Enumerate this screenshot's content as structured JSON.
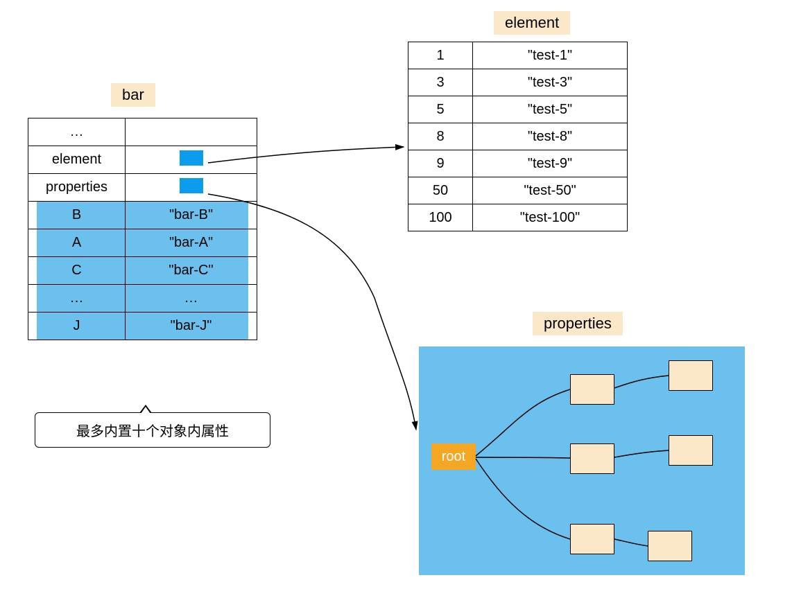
{
  "labels": {
    "bar": "bar",
    "element": "element",
    "properties": "properties"
  },
  "bar_table": {
    "rows": [
      {
        "k": "…",
        "v": ""
      },
      {
        "k": "element",
        "v": "[ptr]"
      },
      {
        "k": "properties",
        "v": "[ptr]"
      }
    ],
    "highlight_rows": [
      {
        "k": "B",
        "v": "\"bar-B\""
      },
      {
        "k": "A",
        "v": "\"bar-A\""
      },
      {
        "k": "C",
        "v": "\"bar-C\""
      },
      {
        "k": "…",
        "v": "…"
      },
      {
        "k": "J",
        "v": "\"bar-J\""
      }
    ]
  },
  "callout_text": "最多内置十个对象内属性",
  "element_table": [
    {
      "k": "1",
      "v": "\"test-1\""
    },
    {
      "k": "3",
      "v": "\"test-3\""
    },
    {
      "k": "5",
      "v": "\"test-5\""
    },
    {
      "k": "8",
      "v": "\"test-8\""
    },
    {
      "k": "9",
      "v": "\"test-9\""
    },
    {
      "k": "50",
      "v": "\"test-50\""
    },
    {
      "k": "100",
      "v": "\"test-100\""
    }
  ],
  "properties_tree": {
    "root": "root"
  }
}
